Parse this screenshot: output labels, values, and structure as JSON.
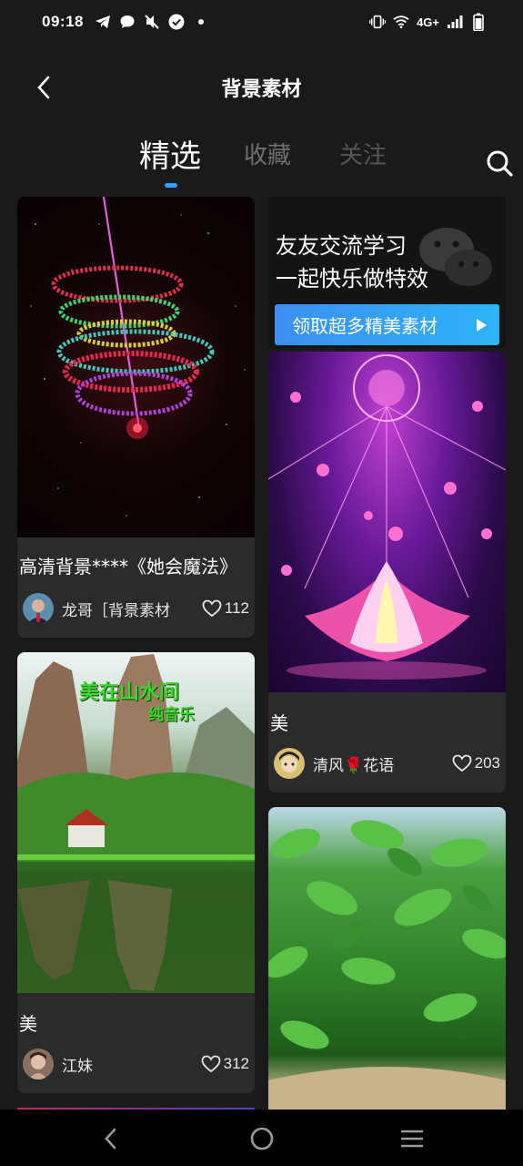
{
  "status_bar": {
    "time": "09:18",
    "left_icons": [
      "telegram-icon",
      "chat-bubble-icon",
      "muted-speaker-icon",
      "check-circle-icon",
      "dot-icon"
    ],
    "network": "4G+",
    "right_icons": [
      "vibrate-icon",
      "wifi-icon",
      "signal-icon",
      "battery-icon"
    ]
  },
  "header": {
    "back_icon": "chevron-left-icon",
    "title": "背景素材"
  },
  "tabs": [
    {
      "label": "精选",
      "active": true
    },
    {
      "label": "收藏",
      "active": false
    },
    {
      "label": "关注",
      "active": false
    }
  ],
  "search_icon": "search-icon",
  "accent_color": "#2ea0ff",
  "ad": {
    "line1": "友友交流学习",
    "line2": "一起快乐做特效",
    "button_label": "领取超多精美素材"
  },
  "cards": [
    {
      "title": "高清背景****《她会魔法》",
      "author": "龙哥［背景素材",
      "likes": "112"
    },
    {
      "title": "美",
      "author": "江妹",
      "likes": "312",
      "image_text_1": "美在山水间",
      "image_text_2": "纯音乐"
    },
    {
      "title": "美",
      "author": "清风🌹花语",
      "likes": "203"
    },
    {
      "title": "",
      "author": "",
      "likes": ""
    }
  ],
  "nav_bar": {
    "icons": [
      "back-triangle-icon",
      "home-circle-icon",
      "recents-menu-icon"
    ]
  }
}
